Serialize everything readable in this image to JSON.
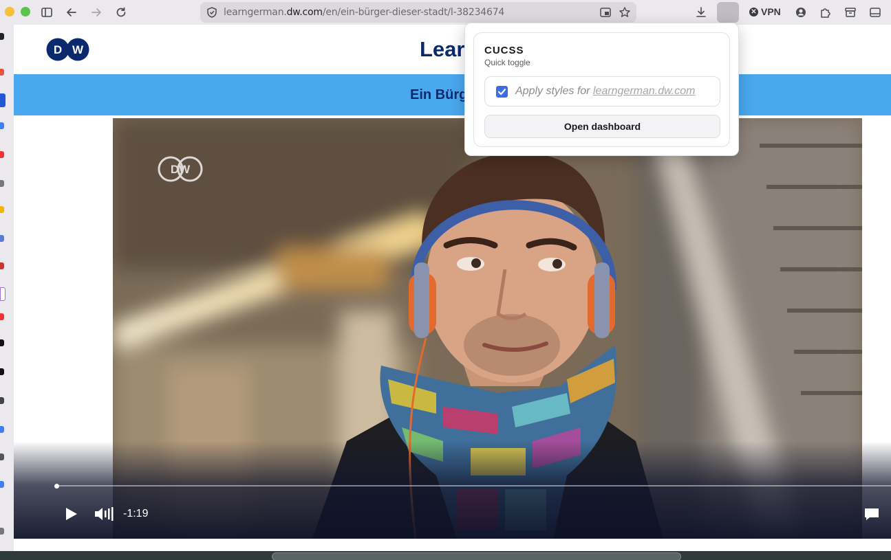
{
  "browser": {
    "url_prefix": "learngerman.",
    "url_domain": "dw.com",
    "url_path": "/en/ein-bürger-dieser-stadt/l-38234674",
    "vpn_label": "VPN",
    "icons": [
      "sidebar-icon",
      "back-icon",
      "forward-icon",
      "reload-icon",
      "shield-icon",
      "picture-in-picture-icon",
      "bookmark-star-icon",
      "download-icon",
      "extension-icon",
      "vpn-icon",
      "account-icon",
      "puzzle-icon",
      "archive-icon",
      "window-icon"
    ]
  },
  "page": {
    "logo_text": "DW",
    "title": "Lear",
    "band_title": "Ein Bürg"
  },
  "video": {
    "watermark": "DW",
    "time_remaining": "-1:19",
    "progress_fraction": 0.003
  },
  "popup": {
    "title": "CUCSS",
    "subtitle": "Quick toggle",
    "toggle_label": "Apply styles for ",
    "toggle_domain": "learngerman.dw.com",
    "toggle_checked": true,
    "dashboard_label": "Open dashboard"
  },
  "colors": {
    "accent": "#3b6fe0",
    "dw_blue": "#0b2a6e",
    "band_blue": "#4aa8ef"
  }
}
